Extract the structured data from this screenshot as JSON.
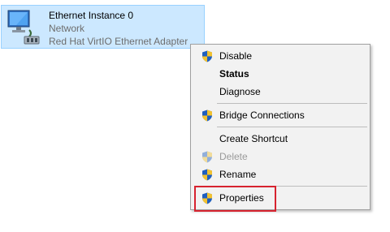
{
  "adapter": {
    "name": "Ethernet Instance 0",
    "network": "Network",
    "device": "Red Hat VirtIO Ethernet Adapter",
    "icon": "network-adapter-icon"
  },
  "menu": {
    "items": [
      {
        "label": "Disable",
        "shield": true,
        "bold": false,
        "enabled": true
      },
      {
        "label": "Status",
        "shield": false,
        "bold": true,
        "enabled": true
      },
      {
        "label": "Diagnose",
        "shield": false,
        "bold": false,
        "enabled": true
      },
      {
        "label": "Bridge Connections",
        "shield": true,
        "bold": false,
        "enabled": true
      },
      {
        "label": "Create Shortcut",
        "shield": false,
        "bold": false,
        "enabled": true
      },
      {
        "label": "Delete",
        "shield": true,
        "bold": false,
        "enabled": false
      },
      {
        "label": "Rename",
        "shield": true,
        "bold": false,
        "enabled": true
      },
      {
        "label": "Properties",
        "shield": true,
        "bold": false,
        "enabled": true,
        "highlighted": true
      }
    ]
  },
  "colors": {
    "selection": "#cce8ff",
    "highlight_box": "#d7232f",
    "shield_blue": "#1f5fbf",
    "shield_yellow": "#f2c230"
  }
}
